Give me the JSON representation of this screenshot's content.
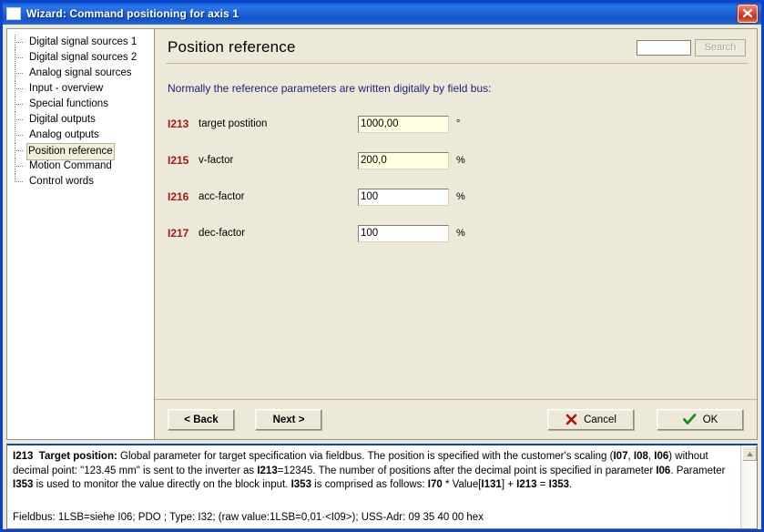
{
  "window": {
    "title": "Wizard: Command positioning for axis 1",
    "icon": "window-icon",
    "close_label": "close-icon",
    "accent_color": "#0a42c8",
    "titlebar_color": "#1f63da",
    "face_color": "#ece9d8"
  },
  "sidebar": {
    "items": [
      {
        "label": "Digital signal sources 1",
        "selected": false
      },
      {
        "label": "Digital signal sources 2",
        "selected": false
      },
      {
        "label": "Analog signal sources",
        "selected": false
      },
      {
        "label": "Input - overview",
        "selected": false
      },
      {
        "label": "Special functions",
        "selected": false
      },
      {
        "label": "Digital outputs",
        "selected": false
      },
      {
        "label": "Analog outputs",
        "selected": false
      },
      {
        "label": "Position reference",
        "selected": true
      },
      {
        "label": "Motion Command",
        "selected": false
      },
      {
        "label": "Control words",
        "selected": false
      }
    ]
  },
  "main": {
    "title": "Position reference",
    "intro": "Normally the reference parameters are written digitally by field bus:",
    "search": {
      "value": "",
      "placeholder": "",
      "button_label": "Search",
      "button_enabled": false
    },
    "parameters": [
      {
        "code": "I213",
        "name": "target postition",
        "value": "1000,00",
        "unit": "°",
        "tinted": true
      },
      {
        "code": "I215",
        "name": "v-factor",
        "value": "200,0",
        "unit": "%",
        "tinted": true
      },
      {
        "code": "I216",
        "name": "acc-factor",
        "value": "100",
        "unit": "%",
        "tinted": false
      },
      {
        "code": "I217",
        "name": "dec-factor",
        "value": "100",
        "unit": "%",
        "tinted": false
      }
    ],
    "param_code_color": "#a01818",
    "field_tint_color": "#ffffe1"
  },
  "buttons": {
    "back": "< Back",
    "next": "Next >",
    "cancel": "Cancel",
    "ok": "OK",
    "cancel_icon": "red-x-icon",
    "ok_icon": "green-check-icon"
  },
  "help": {
    "title_code": "I213",
    "title_text": "Target position:",
    "body_1": " Global parameter for target specification via fieldbus. The position is specified with the customer's scaling (",
    "ref_i07": "I07",
    "sep_1": ", ",
    "ref_i08": "I08",
    "sep_2": ", ",
    "ref_i06": "I06",
    "body_2": ") without decimal point: \"123.45 mm\" is sent to the inverter as ",
    "ref_i213a": "I213",
    "body_3": "=12345. The number of positions after the decimal point is specified in parameter ",
    "ref_i06b": "I06",
    "body_4": ". Parameter ",
    "ref_i353a": "I353",
    "body_5": " is used to monitor the value directly on the block input. ",
    "ref_i353b": "I353",
    "body_6": " is comprised as follows: ",
    "ref_i70": "I70",
    "body_7": " * Value[",
    "ref_i131": "I131",
    "body_8": "] + ",
    "ref_i213b": "I213",
    "body_9": " = ",
    "ref_i353c": "I353",
    "body_10": ".",
    "fieldbus": "Fieldbus: 1LSB=siehe I06; PDO ; Type: I32; (raw value:1LSB=0,01·<I09>); USS-Adr: 09 35 40 00 hex",
    "scroll_up_icon": "scroll-up-arrow-icon"
  }
}
